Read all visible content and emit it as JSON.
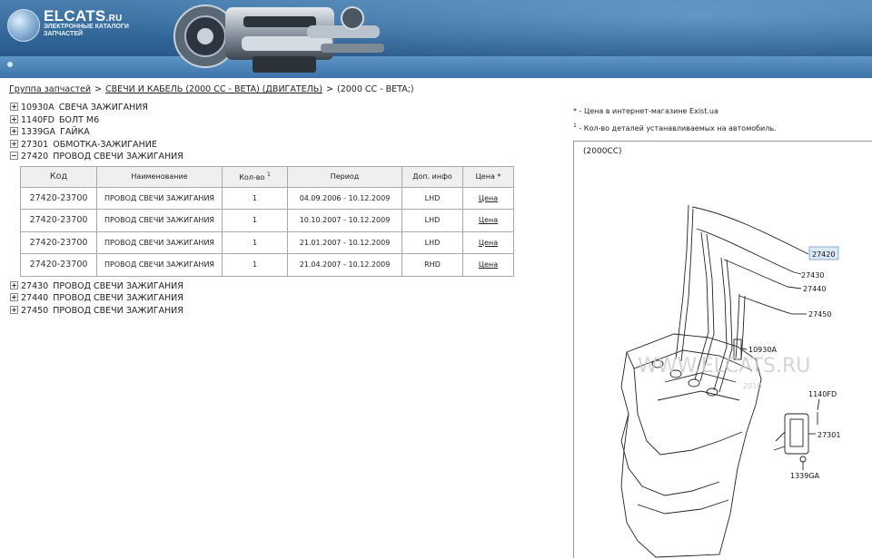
{
  "header": {
    "logo_name": "ELCATS",
    "logo_suffix": ".RU",
    "logo_tagline": "ЭЛЕКТРОННЫЕ КАТАЛОГИ ЗАПЧАСТЕЙ"
  },
  "breadcrumb": {
    "items": [
      "Группа запчастей",
      "СВЕЧИ И КАБЕЛЬ (2000 CC - BETA) (ДВИГАТЕЛЬ)",
      "(2000 CC - BETA;)"
    ],
    "separator": ">"
  },
  "tree": {
    "items": [
      {
        "code": "10930A",
        "name": "СВЕЧА ЗАЖИГАНИЯ",
        "state": "collapsed"
      },
      {
        "code": "1140FD",
        "name": "БОЛТ M6",
        "state": "collapsed"
      },
      {
        "code": "1339GA",
        "name": "ГАЙКА",
        "state": "collapsed"
      },
      {
        "code": "27301",
        "name": "ОБМОТКА-ЗАЖИГАНИЕ",
        "state": "collapsed"
      },
      {
        "code": "27420",
        "name": "ПРОВОД СВЕЧИ ЗАЖИГАНИЯ",
        "state": "expanded"
      },
      {
        "code": "27430",
        "name": "ПРОВОД СВЕЧИ ЗАЖИГАНИЯ",
        "state": "collapsed"
      },
      {
        "code": "27440",
        "name": "ПРОВОД СВЕЧИ ЗАЖИГАНИЯ",
        "state": "collapsed"
      },
      {
        "code": "27450",
        "name": "ПРОВОД СВЕЧИ ЗАЖИГАНИЯ",
        "state": "collapsed"
      }
    ]
  },
  "table": {
    "headers": {
      "code": "Код",
      "name": "Наименование",
      "qty": "Кол-во",
      "qty_sup": "1",
      "period": "Период",
      "info": "Доп. инфо",
      "price": "Цена *"
    },
    "rows": [
      {
        "code": "27420-23700",
        "name": "ПРОВОД СВЕЧИ ЗАЖИГАНИЯ",
        "qty": "1",
        "period": "04.09.2006 - 10.12.2009",
        "info": "LHD",
        "price": "Цена"
      },
      {
        "code": "27420-23700",
        "name": "ПРОВОД СВЕЧИ ЗАЖИГАНИЯ",
        "qty": "1",
        "period": "10.10.2007 - 10.12.2009",
        "info": "LHD",
        "price": "Цена"
      },
      {
        "code": "27420-23700",
        "name": "ПРОВОД СВЕЧИ ЗАЖИГАНИЯ",
        "qty": "1",
        "period": "21.01.2007 - 10.12.2009",
        "info": "LHD",
        "price": "Цена"
      },
      {
        "code": "27420-23700",
        "name": "ПРОВОД СВЕЧИ ЗАЖИГАНИЯ",
        "qty": "1",
        "period": "21.04.2007 - 10.12.2009",
        "info": "RHD",
        "price": "Цена"
      }
    ]
  },
  "notes": {
    "price_marker": "*",
    "price_text": "- Цена в интернет-магазине Exist.ua",
    "qty_marker": "1",
    "qty_text": "- Кол-во деталей устанавливаемых на автомобиль."
  },
  "diagram": {
    "title": "(2000CC)",
    "watermark": "WWW.ELCATS.RU",
    "watermark_date": "2016",
    "callouts": {
      "c27420": "27420",
      "c27430": "27430",
      "c27440": "27440",
      "c27450": "27450",
      "c10930A": "10930A",
      "c1140FD": "1140FD",
      "c27301": "27301",
      "c1339GA": "1339GA"
    },
    "highlight_color": "#dbe9f7"
  }
}
